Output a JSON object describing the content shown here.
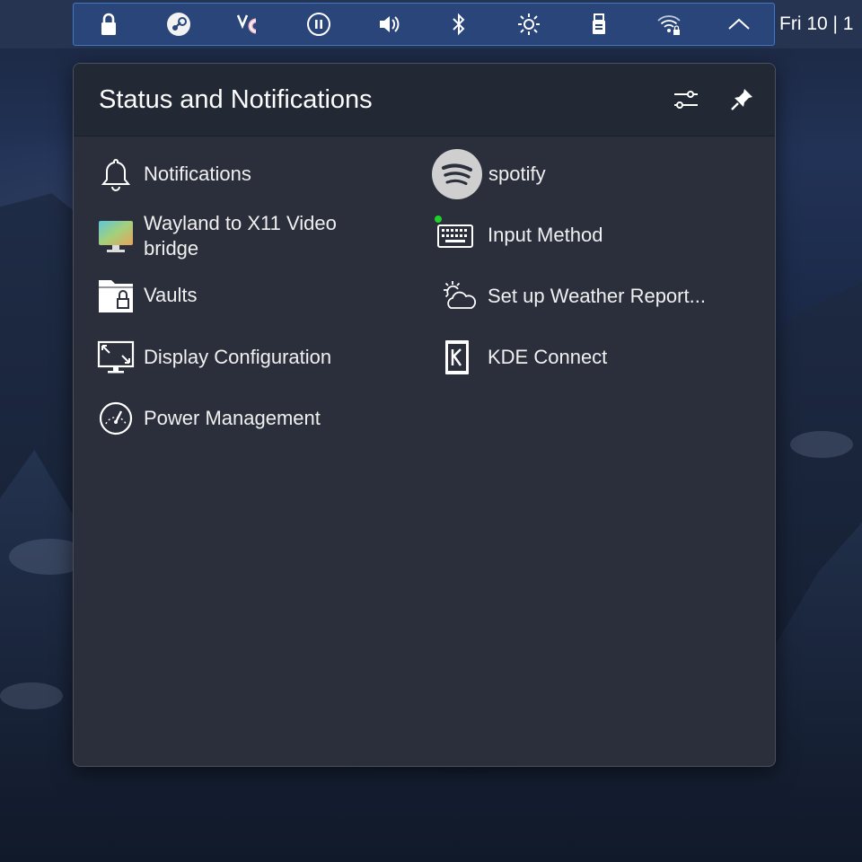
{
  "panel": {
    "clock": "Fri 10 | 1",
    "tray_icons": [
      {
        "name": "lock-icon"
      },
      {
        "name": "steam-icon"
      },
      {
        "name": "vc-app-icon"
      },
      {
        "name": "media-pause-icon"
      },
      {
        "name": "volume-icon"
      },
      {
        "name": "bluetooth-icon"
      },
      {
        "name": "brightness-icon"
      },
      {
        "name": "usb-device-icon"
      },
      {
        "name": "wifi-locked-icon"
      },
      {
        "name": "chevron-up-icon"
      }
    ]
  },
  "popup": {
    "title": "Status and Notifications",
    "configure_icon": "sliders-icon",
    "pin_icon": "pin-icon",
    "left_items": [
      {
        "label": "Notifications",
        "icon": "bell-icon"
      },
      {
        "label": "Wayland to X11 Video bridge",
        "icon": "video-bridge-icon"
      },
      {
        "label": "Vaults",
        "icon": "vault-icon"
      },
      {
        "label": "Display Configuration",
        "icon": "display-icon"
      },
      {
        "label": "Power Management",
        "icon": "power-gauge-icon"
      }
    ],
    "right_items": [
      {
        "label": "spotify",
        "icon": "spotify-icon"
      },
      {
        "label": "Input Method",
        "icon": "keyboard-icon"
      },
      {
        "label": "Set up Weather Report...",
        "icon": "weather-icon"
      },
      {
        "label": "KDE Connect",
        "icon": "kde-connect-icon"
      }
    ]
  },
  "colors": {
    "accent": "#3e79c9",
    "popup_bg": "#2a2f3b",
    "status_dot": "#1fd12a"
  }
}
